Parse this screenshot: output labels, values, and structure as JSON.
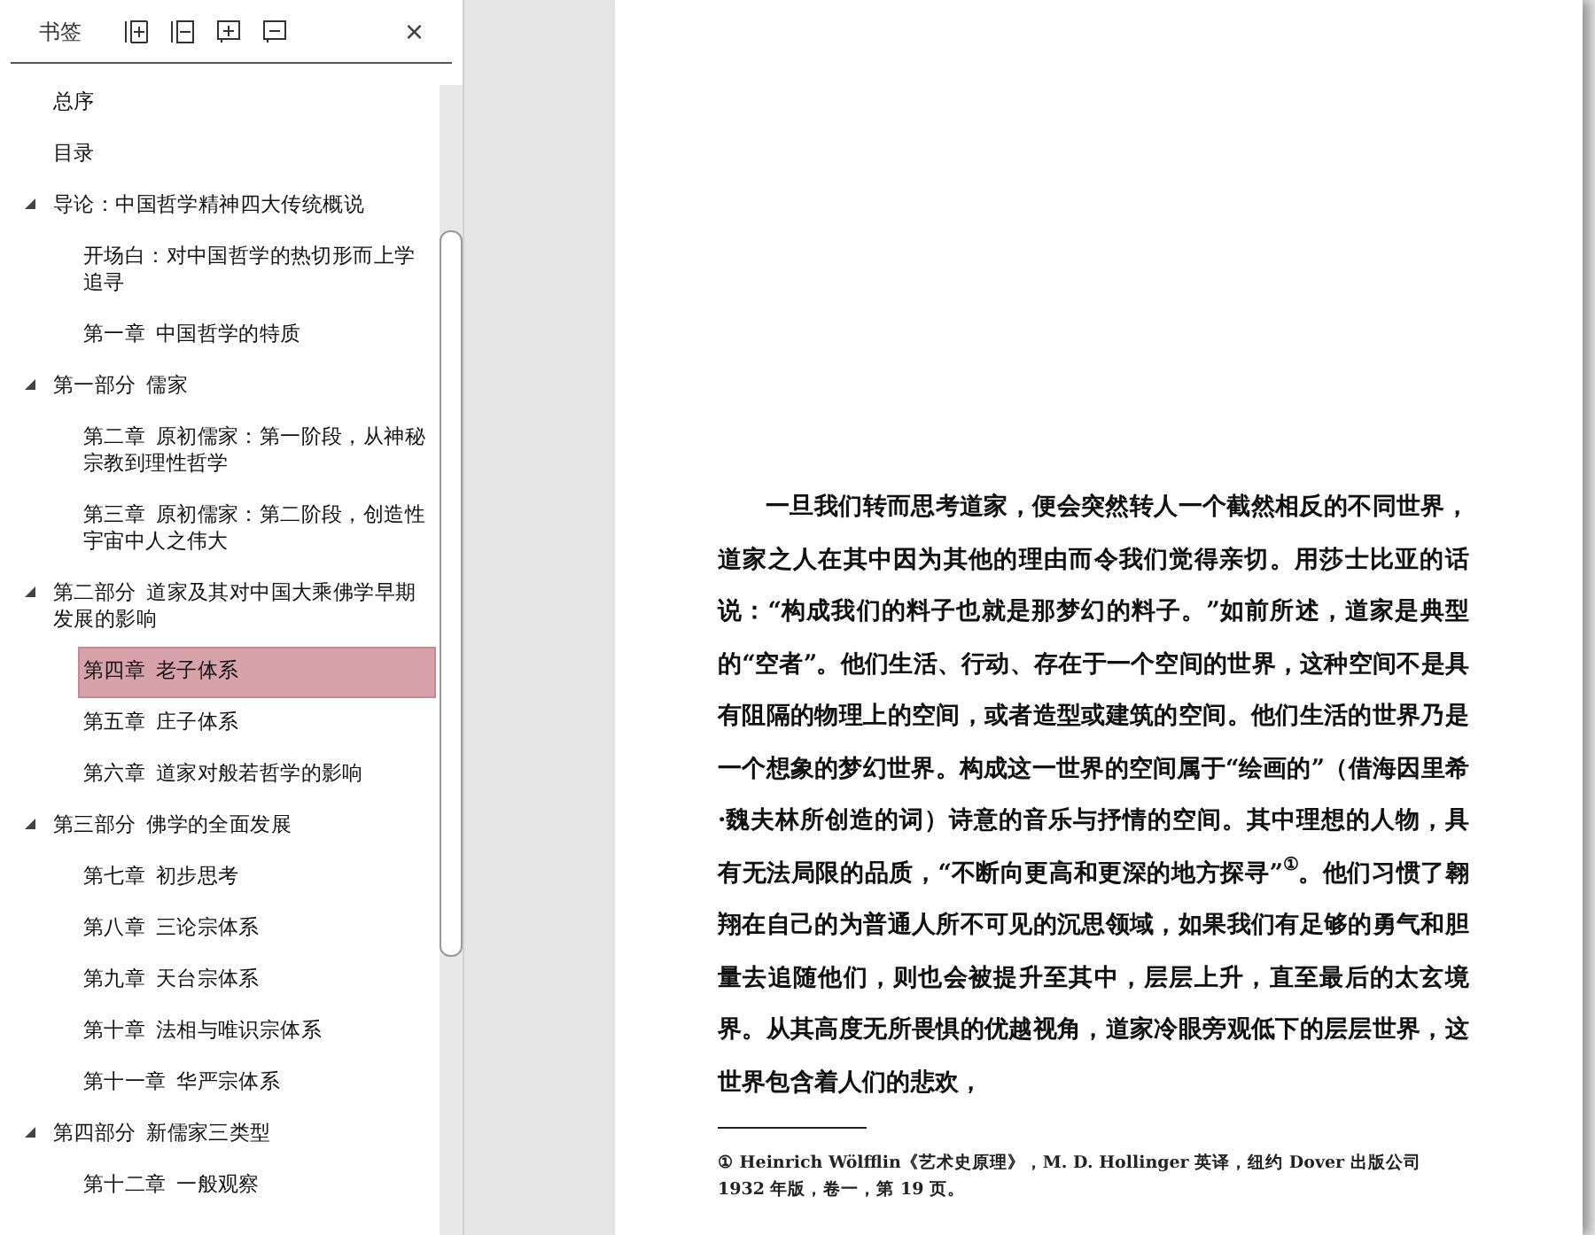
{
  "sidebar": {
    "title": "书签",
    "close": "×",
    "items": [
      {
        "label": "总序",
        "selected": false
      },
      {
        "label": "目录",
        "selected": false
      },
      {
        "label": "导论：中国哲学精神四大传统概说",
        "expanded": true,
        "selected": false,
        "children": [
          {
            "label": "开场白：对中国哲学的热切形而上学追寻",
            "selected": false
          },
          {
            "label": "第一章  中国哲学的特质",
            "selected": false
          }
        ]
      },
      {
        "label": "第一部分  儒家",
        "expanded": true,
        "selected": false,
        "children": [
          {
            "label": "第二章  原初儒家：第一阶段，从神秘宗教到理性哲学",
            "selected": false
          },
          {
            "label": "第三章  原初儒家：第二阶段，创造性宇宙中人之伟大",
            "selected": false
          }
        ]
      },
      {
        "label": "第二部分  道家及其对中国大乘佛学早期发展的影响",
        "expanded": true,
        "selected": false,
        "children": [
          {
            "label": "第四章  老子体系",
            "selected": true
          },
          {
            "label": "第五章  庄子体系",
            "selected": false
          },
          {
            "label": "第六章  道家对般若哲学的影响",
            "selected": false
          }
        ]
      },
      {
        "label": "第三部分  佛学的全面发展",
        "expanded": true,
        "selected": false,
        "children": [
          {
            "label": "第七章  初步思考",
            "selected": false
          },
          {
            "label": "第八章  三论宗体系",
            "selected": false
          },
          {
            "label": "第九章  天台宗体系",
            "selected": false
          },
          {
            "label": "第十章  法相与唯识宗体系",
            "selected": false
          },
          {
            "label": "第十一章  华严宗体系",
            "selected": false
          }
        ]
      },
      {
        "label": "第四部分  新儒家三类型",
        "expanded": true,
        "selected": false,
        "children": [
          {
            "label": "第十二章  一般观察",
            "selected": false
          }
        ]
      }
    ]
  },
  "page": {
    "paragraph": "一旦我们转而思考道家，便会突然转人一个截然相反的不同世界，道家之人在其中因为其他的理由而令我们觉得亲切。用莎士比亚的话说：“构成我们的料子也就是那梦幻的料子。”如前所述，道家是典型的“空者”。他们生活、行动、存在于一个空间的世界，这种空间不是具有阻隔的物理上的空间，或者造型或建筑的空间。他们生活的世界乃是一个想象的梦幻世界。构成这一世界的空间属于“绘画的”（借海因里希·魏夫林所创造的词）诗意的音乐与抒情的空间。其中理想的人物，具有无法局限的品质，“不断向更高和更深的地方探寻”$^{①}$。他们习惯了翱翔在自己的为普通人所不可见的沉思领域，如果我们有足够的勇气和胆量去追随他们，则也会被提升至其中，层层上升，直至最后的太玄境界。从其高度无所畏惧的优越视角，道家冷眼旁观低下的层层世界，这世界包含着人们的悲欢，",
    "footnote": "①  Heinrich Wölfflin《艺术史原理》，M. D. Hollinger 英译，纽约 Dover 出版公司 1932 年版，卷一，第 19 页。"
  }
}
